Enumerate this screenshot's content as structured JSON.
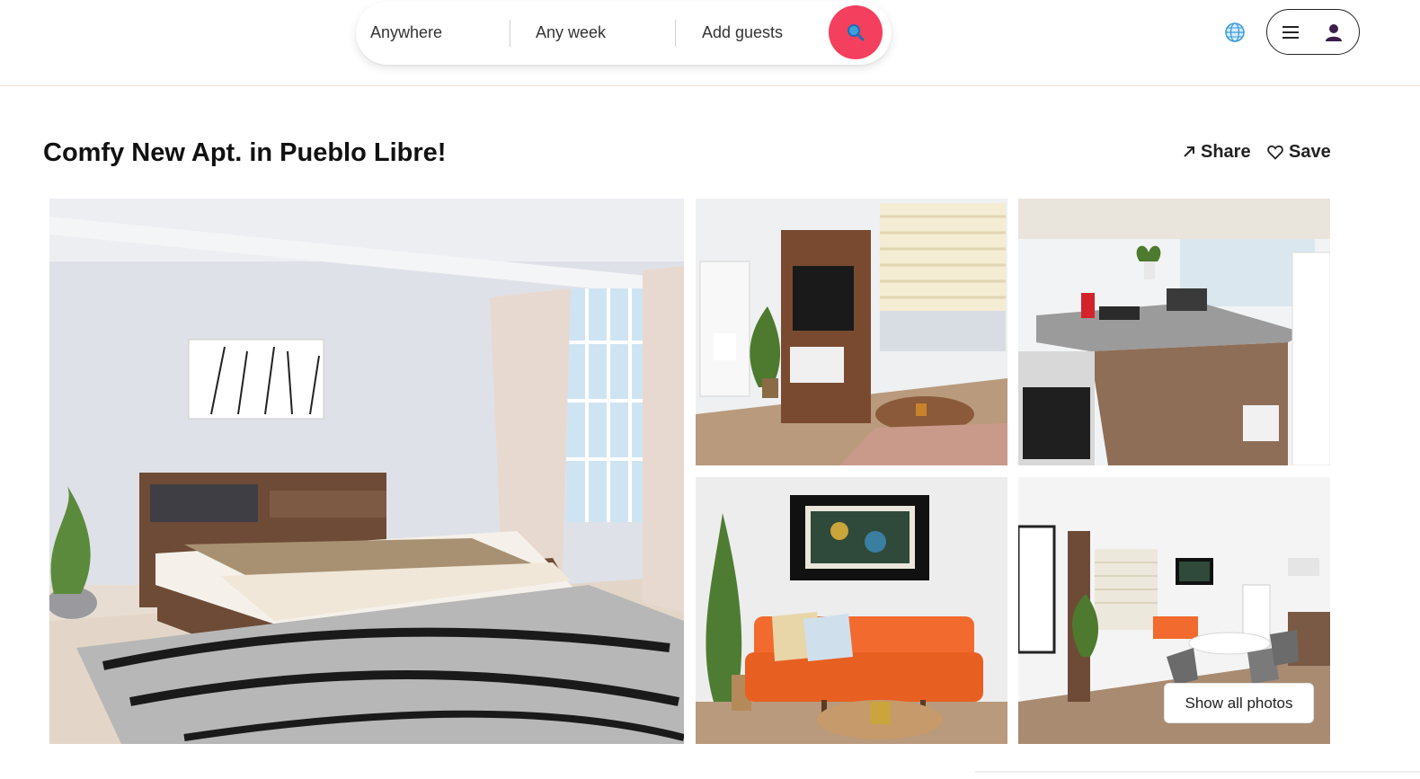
{
  "search": {
    "where": "Anywhere",
    "when": "Any week",
    "guests": "Add guests"
  },
  "listing": {
    "title": "Comfy New Apt. in Pueblo Libre!",
    "share_label": "Share",
    "save_label": "Save"
  },
  "gallery": {
    "show_all_label": "Show all photos"
  },
  "icons": {
    "search": "search-icon",
    "globe": "globe-icon",
    "menu": "hamburger-menu-icon",
    "user": "user-icon",
    "share": "share-arrow-icon",
    "save": "heart-icon"
  },
  "colors": {
    "accent": "#f43f5e",
    "text": "#222222",
    "sofa": "#f26a2e",
    "wood": "#6e4b36"
  }
}
